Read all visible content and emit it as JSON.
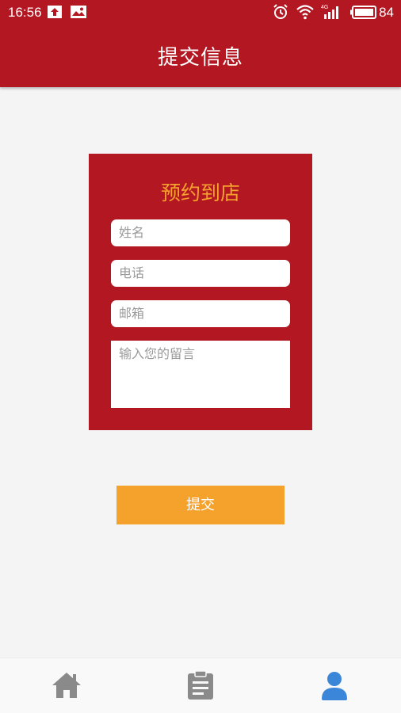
{
  "status_bar": {
    "time": "16:56",
    "battery_level": "84",
    "network_label": "4G",
    "icons": [
      "upload-icon",
      "image-icon",
      "alarm-icon",
      "wifi-icon",
      "signal-icon",
      "battery-icon"
    ]
  },
  "header": {
    "title": "提交信息",
    "background_color": "#b31722"
  },
  "form": {
    "title": "预约到店",
    "title_color": "#f5a22d",
    "name_placeholder": "姓名",
    "phone_placeholder": "电话",
    "email_placeholder": "邮箱",
    "message_placeholder": "输入您的留言",
    "submit_label": "提交",
    "submit_color": "#f5a22d"
  },
  "bottom_nav": {
    "items": [
      {
        "icon": "home-icon",
        "active": false
      },
      {
        "icon": "clipboard-icon",
        "active": false
      },
      {
        "icon": "user-icon",
        "active": true
      }
    ],
    "active_color": "#3b86d8",
    "inactive_color": "#8a8a8a"
  }
}
